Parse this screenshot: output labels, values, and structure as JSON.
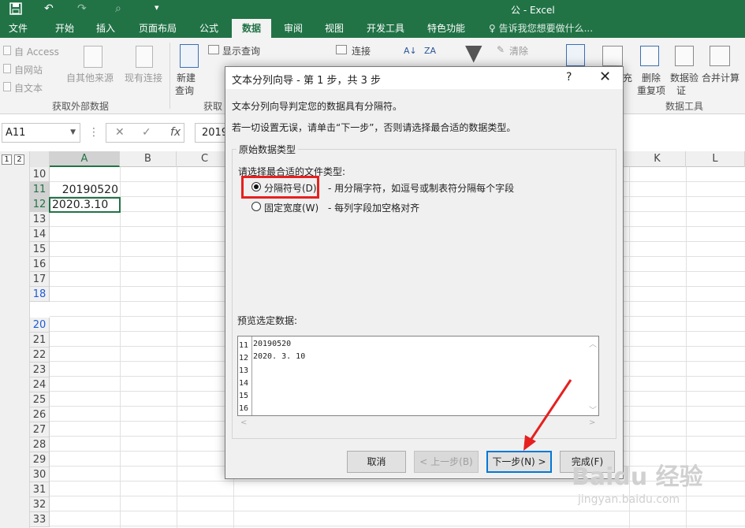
{
  "titlebar": {
    "title": "公 - Excel",
    "undo": "↶",
    "redo": "↷",
    "customize": "▾"
  },
  "tabs": [
    {
      "label": "文件"
    },
    {
      "label": "开始"
    },
    {
      "label": "插入"
    },
    {
      "label": "页面布局"
    },
    {
      "label": "公式"
    },
    {
      "label": "数据"
    },
    {
      "label": "审阅"
    },
    {
      "label": "视图"
    },
    {
      "label": "开发工具"
    },
    {
      "label": "特色功能"
    }
  ],
  "tellme": "♀ 告诉我您想要做什么...",
  "ribbon": {
    "from_access": "自 Access",
    "from_web": "自网站",
    "from_text": "自文本",
    "from_other": "自其他来源",
    "existing_conn": "现有连接",
    "group_external": "获取外部数据",
    "new_query": "新建",
    "new_query2": "查询",
    "show_queries": "显示查询",
    "group_get": "获取",
    "connections": "连接",
    "clear": "清除",
    "fill_partial": "充",
    "remove_dup": "删除",
    "remove_dup2": "重复项",
    "data_val": "数据验",
    "data_val2": "证",
    "consolidate": "合并计算",
    "group_tools": "数据工具"
  },
  "formula_bar": {
    "name_box": "A11",
    "cancel": "✕",
    "enter": "✓",
    "fx": "fx",
    "value": "2019"
  },
  "sheet": {
    "outline_levels": [
      "1",
      "2"
    ],
    "columns": [
      "A",
      "B",
      "C",
      "K",
      "L"
    ],
    "rows": [
      "10",
      "11",
      "12",
      "13",
      "14",
      "15",
      "16",
      "17",
      "18",
      "20",
      "21",
      "22",
      "23",
      "24",
      "25",
      "26",
      "27",
      "28",
      "29",
      "30",
      "31",
      "32",
      "33"
    ],
    "cell_a11": "20190520",
    "cell_a12": "2020.3.10"
  },
  "dialog": {
    "title": "文本分列向导 - 第 1 步，共 3 步",
    "help": "?",
    "close": "✕",
    "intro1": "文本分列向导判定您的数据具有分隔符。",
    "intro2": "若一切设置无误，请单击“下一步”，否则请选择最合适的数据类型。",
    "group_label": "原始数据类型",
    "choose_label": "请选择最合适的文件类型:",
    "opt_delimited": "分隔符号(D)",
    "opt_delimited_desc": "- 用分隔字符，如逗号或制表符分隔每个字段",
    "opt_fixed": "固定宽度(W)",
    "opt_fixed_desc": "- 每列字段加空格对齐",
    "preview_label": "预览选定数据:",
    "preview_rows": [
      {
        "num": "11",
        "text": "20190520"
      },
      {
        "num": "12",
        "text": "2020. 3. 10"
      },
      {
        "num": "13",
        "text": ""
      },
      {
        "num": "14",
        "text": ""
      },
      {
        "num": "15",
        "text": ""
      },
      {
        "num": "16",
        "text": ""
      }
    ],
    "btn_cancel": "取消",
    "btn_back": "< 上一步(B)",
    "btn_next": "下一步(N) >",
    "btn_finish": "完成(F)"
  },
  "watermark": {
    "brand": "Baidu 经验",
    "url": "jingyan.baidu.com"
  },
  "colors": {
    "excel_green": "#217346",
    "highlight_red": "#e62020",
    "focus_blue": "#0078d7"
  }
}
